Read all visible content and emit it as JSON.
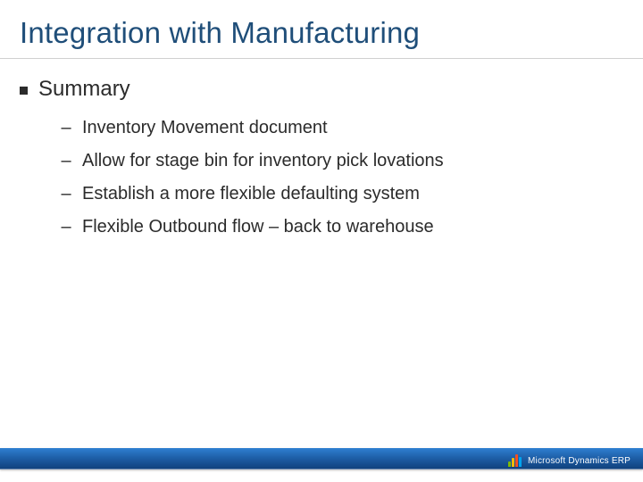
{
  "title": "Integration with Manufacturing",
  "summary": {
    "heading": "Summary",
    "items": [
      "Inventory Movement document",
      "Allow for stage bin for inventory pick lovations",
      "Establish a more flexible defaulting system",
      "Flexible Outbound flow – back to warehouse"
    ]
  },
  "brand": {
    "name": "Microsoft",
    "product": "Dynamics ERP"
  }
}
